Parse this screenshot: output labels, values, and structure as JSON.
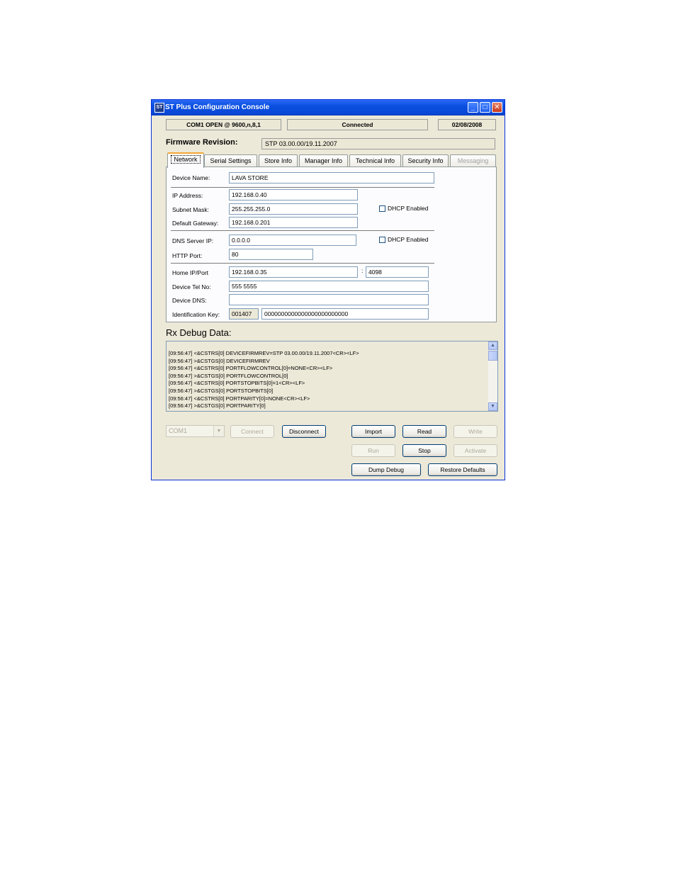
{
  "window": {
    "title": "ST Plus Configuration Console",
    "icon_text": "ST",
    "controls": {
      "minimize": "_",
      "maximize": "□",
      "close": "✕"
    }
  },
  "status": {
    "port": "COM1 OPEN @ 9600,n,8,1",
    "connection": "Connected",
    "date": "02/08/2008"
  },
  "firmware": {
    "label": "Firmware Revision:",
    "value": "STP 03.00.00/19.11.2007"
  },
  "tabs": [
    "Network",
    "Serial Settings",
    "Store Info",
    "Manager Info",
    "Technical Info",
    "Security Info",
    "Messaging"
  ],
  "network": {
    "device_name_label": "Device Name:",
    "device_name": "LAVA STORE",
    "ip_label": "IP Address:",
    "ip": "192.168.0.40",
    "subnet_label": "Subnet Mask:",
    "subnet": "255.255.255.0",
    "gateway_label": "Default Gateway:",
    "gateway": "192.168.0.201",
    "dhcp_label": "DHCP Enabled",
    "dns_label": "DNS Server IP:",
    "dns": "0.0.0.0",
    "dns_dhcp_label": "DHCP Enabled",
    "http_label": "HTTP Port:",
    "http": "80",
    "home_label": "Home IP/Port",
    "home_ip": "192.168.0.35",
    "home_sep": ":",
    "home_port": "4098",
    "tel_label": "Device Tel No:",
    "tel": "555 5555",
    "devdns_label": "Device DNS:",
    "devdns": "",
    "key_label": "Identification Key:",
    "key_prefix": "001407",
    "key": "0000000000000000000000000"
  },
  "rx": {
    "label": "Rx Debug Data:",
    "lines": [
      "[09:56:47] <&CSTRS[0] DEVICEFIRMREV=STP 03.00.00/19.11.2007<CR><LF>",
      "[09:56:47] >&CSTGS[0] DEVICEFIRMREV",
      "[09:56:47] <&CSTRS[0] PORTFLOWCONTROL[0]=NONE<CR><LF>",
      "[09:56:47] >&CSTGS[0] PORTFLOWCONTROL[0]",
      "[09:56:47] <&CSTRS[0] PORTSTOPBITS[0]=1<CR><LF>",
      "[09:56:47] >&CSTGS[0] PORTSTOPBITS[0]",
      "[09:56:47] <&CSTRS[0] PORTPARITY[0]=NONE<CR><LF>",
      "[09:56:47] >&CSTGS[0] PORTPARITY[0]"
    ]
  },
  "controls": {
    "com_port": "COM1",
    "connect": "Connect",
    "disconnect": "Disconnect",
    "import": "Import",
    "read": "Read",
    "write": "Write",
    "run": "Run",
    "stop": "Stop",
    "activate": "Activate",
    "dump_debug": "Dump Debug",
    "restore_defaults": "Restore Defaults"
  }
}
